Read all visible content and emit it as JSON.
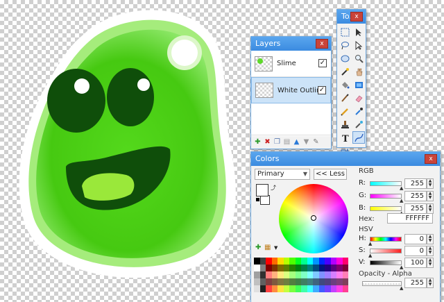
{
  "layers_panel": {
    "title": "Layers",
    "close": "x",
    "layers": [
      {
        "name": "Slime",
        "visible": true,
        "selected": false
      },
      {
        "name": "White Outline",
        "visible": true,
        "selected": true
      }
    ],
    "check_mark": "✓"
  },
  "tools_panel": {
    "title": "To...",
    "close": "x",
    "tools": [
      "rectangle-select-icon",
      "move-selection-icon",
      "lasso-select-icon",
      "move-selection-outline-icon",
      "ellipse-select-icon",
      "zoom-icon",
      "magic-wand-icon",
      "pan-icon",
      "paint-bucket-icon",
      "gradient-icon",
      "paintbrush-icon",
      "eraser-icon",
      "pencil-icon",
      "color-picker-icon",
      "clone-stamp-icon",
      "recolor-icon",
      "text-icon",
      "line-curve-icon",
      "shapes-icon"
    ]
  },
  "colors_panel": {
    "title": "Colors",
    "close": "x",
    "mode_select": "Primary",
    "less_button": "<< Less",
    "rgb_label": "RGB",
    "hsv_label": "HSV",
    "hex_label": "Hex:",
    "opacity_label": "Opacity - Alpha",
    "fields": {
      "r": {
        "label": "R:",
        "value": "255"
      },
      "g": {
        "label": "G:",
        "value": "255"
      },
      "b": {
        "label": "B:",
        "value": "255"
      },
      "hex": "FFFFFF",
      "h": {
        "label": "H:",
        "value": "0"
      },
      "s": {
        "label": "S:",
        "value": "0"
      },
      "v": {
        "label": "V:",
        "value": "100"
      },
      "alpha": "255"
    },
    "primary_color": "#ffffff",
    "secondary_color": "#ffffff"
  },
  "canvas": {
    "slime_color": "#5ed92a",
    "outline_color": "#ffffff",
    "eye_color": "#0f4e0a",
    "mouth_tongue_color": "#9ae83a"
  }
}
